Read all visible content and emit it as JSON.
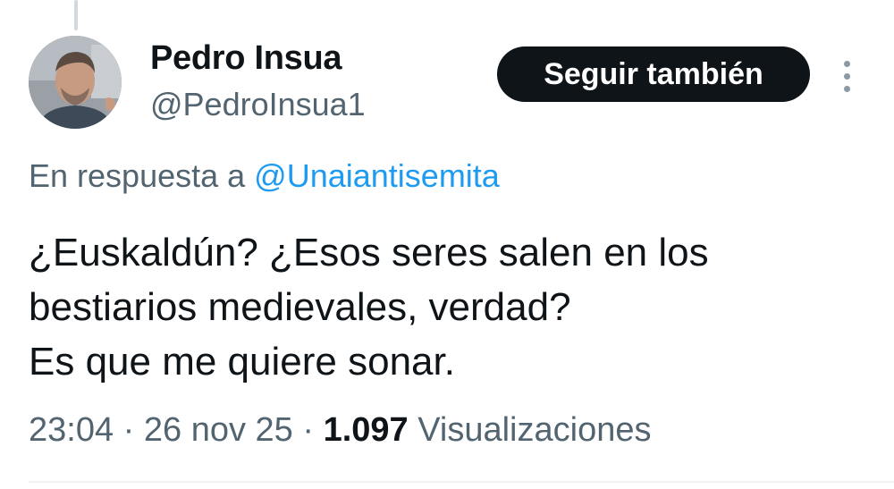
{
  "author": {
    "name": "Pedro Insua",
    "handle": "@PedroInsua1",
    "avatar_icon": "profile-photo"
  },
  "follow_button": {
    "label": "Seguir también"
  },
  "more_icon": "more-vertical-icon",
  "reply": {
    "prefix": "En respuesta a",
    "mention": "@Unaiantisemita"
  },
  "tweet": {
    "lines": [
      "¿Euskaldún? ¿Esos seres salen en los",
      "bestiarios medievales, verdad?",
      "Es que me quiere sonar."
    ]
  },
  "meta": {
    "time": "23:04",
    "date": "26 nov 25",
    "separator": "·",
    "views_count": "1.097",
    "views_label": "Visualizaciones"
  },
  "colors": {
    "text": "#0f1419",
    "secondary": "#536471",
    "link": "#1d9bf0",
    "button_bg": "#0f1419",
    "button_text": "#ffffff"
  }
}
